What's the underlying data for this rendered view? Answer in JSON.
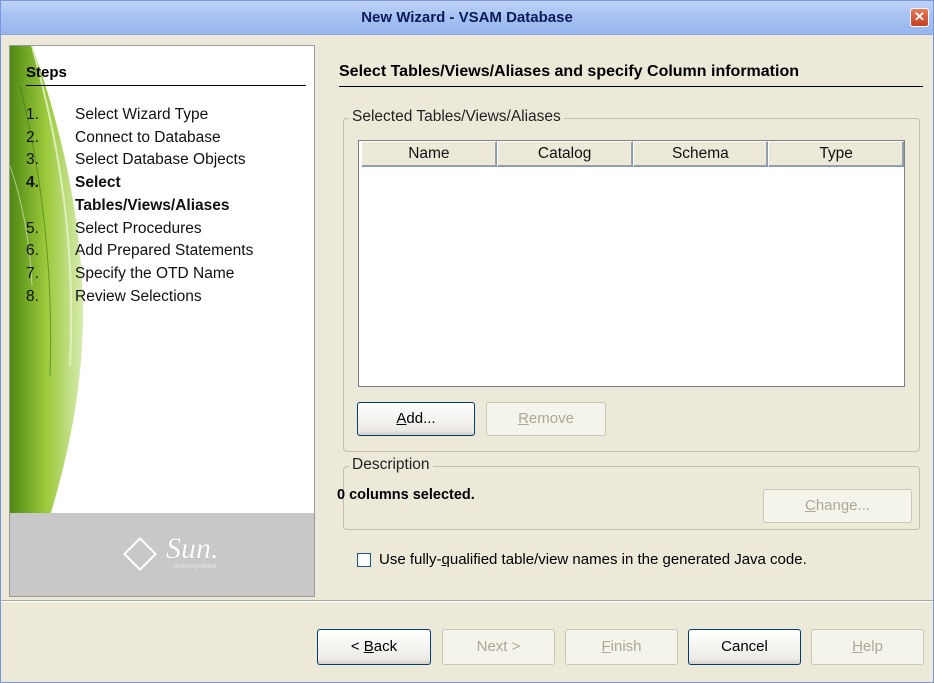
{
  "window": {
    "title": "New Wizard - VSAM Database",
    "close_glyph": "✕"
  },
  "steps": {
    "title": "Steps",
    "items": [
      {
        "num": "1.",
        "label": "Select Wizard Type"
      },
      {
        "num": "2.",
        "label": "Connect to Database"
      },
      {
        "num": "3.",
        "label": "Select Database Objects"
      },
      {
        "num": "4.",
        "label": "Select Tables/Views/Aliases"
      },
      {
        "num": "5.",
        "label": "Select Procedures"
      },
      {
        "num": "6.",
        "label": "Add Prepared Statements"
      },
      {
        "num": "7.",
        "label": "Specify the OTD Name"
      },
      {
        "num": "8.",
        "label": "Review Selections"
      }
    ],
    "current_index": 3
  },
  "logo": {
    "text": "Sun.",
    "subtext": "microsystems"
  },
  "main": {
    "title": "Select Tables/Views/Aliases and specify Column information",
    "selected_group": {
      "legend": "Selected Tables/Views/Aliases",
      "columns": [
        "Name",
        "Catalog",
        "Schema",
        "Type"
      ],
      "rows": [],
      "add_label_mnemonic": "A",
      "add_label_rest": "dd...",
      "remove_label_mnemonic": "R",
      "remove_label_rest": "emove"
    },
    "description_group": {
      "legend": "Description",
      "text": "0 columns selected.",
      "change_label_mnemonic": "C",
      "change_label_rest": "hange..."
    },
    "checkbox": {
      "label_pre": "Use fully-",
      "label_mnemonic": "q",
      "label_post": "ualified table/view names in the generated Java code.",
      "checked": false
    }
  },
  "footer": {
    "back_pre": "< ",
    "back_mnemonic": "B",
    "back_rest": "ack",
    "next_label": "Next >",
    "finish_mnemonic": "F",
    "finish_rest": "inish",
    "cancel_label": "Cancel",
    "help_mnemonic": "H",
    "help_rest": "elp"
  },
  "colors": {
    "titlebar": "#a9c4f3",
    "dialog_bg": "#ece9d8",
    "leaf_green": "#7fae2a",
    "close_red": "#c2401f"
  }
}
